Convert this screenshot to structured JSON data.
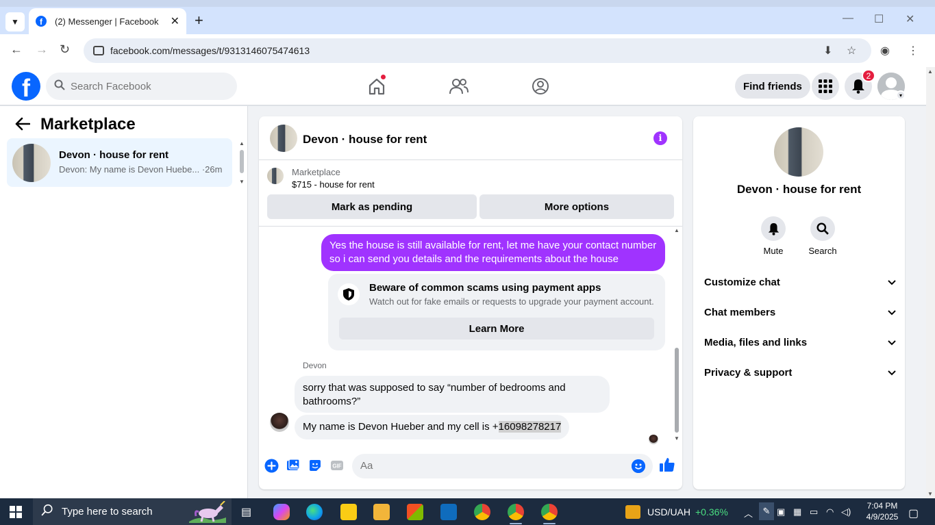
{
  "browser": {
    "tab_title": "(2) Messenger | Facebook",
    "url": "facebook.com/messages/t/9313146075474613"
  },
  "fb": {
    "search_placeholder": "Search Facebook",
    "find_friends": "Find friends",
    "notifications_count": "2"
  },
  "left": {
    "title": "Marketplace",
    "conversation": {
      "name": "Devon · house for rent",
      "snippet": "Devon: My name is Devon Huebe... ·26m"
    }
  },
  "chat": {
    "title": "Devon · house for rent",
    "marketplace": {
      "category": "Marketplace",
      "price": "$715 - house for rent",
      "mark_pending": "Mark as pending",
      "more_options": "More options"
    },
    "outgoing_message": "Yes the house is still available for rent, let me have your contact number so i can send you details and the requirements about the house",
    "scam_warning": {
      "title": "Beware of common scams using payment apps",
      "body": "Watch out for fake emails or requests to upgrade your payment account.",
      "button": "Learn More"
    },
    "sender_name": "Devon",
    "incoming_1": "sorry that was supposed to say “number of bedrooms and bathrooms?”",
    "incoming_2_prefix": "My name is Devon Hueber and my cell is +",
    "incoming_2_number": "16098278217",
    "composer_placeholder": "Aa"
  },
  "right": {
    "name": "Devon · house for rent",
    "actions": {
      "mute": "Mute",
      "search": "Search"
    },
    "sections": [
      "Customize chat",
      "Chat members",
      "Media, files and links",
      "Privacy & support"
    ]
  },
  "taskbar": {
    "search_placeholder": "Type here to search",
    "currency": "USD/UAH",
    "currency_change": "+0.36%",
    "time": "7:04 PM",
    "date": "4/9/2025"
  },
  "colors": {
    "fb_blue": "#0866ff",
    "messenger_purple": "#a033ff",
    "notif_red": "#e41e3f",
    "positive_green": "#4ade80"
  }
}
